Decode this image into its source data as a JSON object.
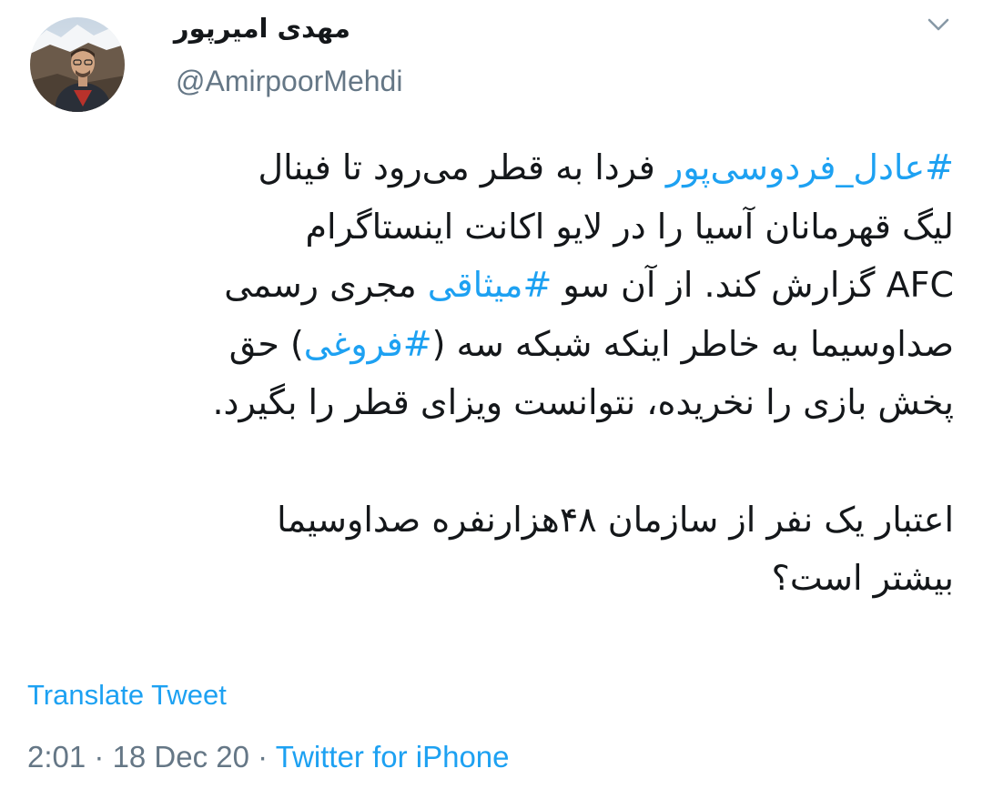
{
  "user": {
    "display_name": "مهدی امیرپور",
    "handle": "@AmirpoorMehdi",
    "avatar_icon": "profile-photo"
  },
  "menu": {
    "icon": "chevron-down-icon"
  },
  "tweet": {
    "lines": [
      {
        "hashtag": "#عادل_فردوسی‌پور",
        "text": " فردا به قطر می‌رود تا فینال"
      },
      {
        "text": "لیگ قهرمانان آسیا را در لایو اکانت اینستاگرام"
      },
      {
        "text_a": "AFC گزارش کند. از آن سو ",
        "hashtag": "#میثاقی",
        "text_b": " مجری رسمی"
      },
      {
        "text_a": "صداوسیما به خاطر اینکه شبکه سه (",
        "hashtag": "#فروغی",
        "text_b": ") حق"
      },
      {
        "text": "پخش بازی را نخریده، نتوانست ویزای قطر را بگیرد."
      },
      {
        "text": "اعتبار یک نفر از سازمان ۴۸هزارنفره صداوسیما"
      },
      {
        "text": "بیشتر است؟"
      }
    ]
  },
  "translate_label": "Translate Tweet",
  "meta": {
    "time": "2:01",
    "separator1": " · ",
    "date": "18 Dec 20",
    "separator2": " · ",
    "source": "Twitter for iPhone"
  },
  "colors": {
    "link": "#1da1f2",
    "secondary": "#657786",
    "text": "#14171a"
  }
}
